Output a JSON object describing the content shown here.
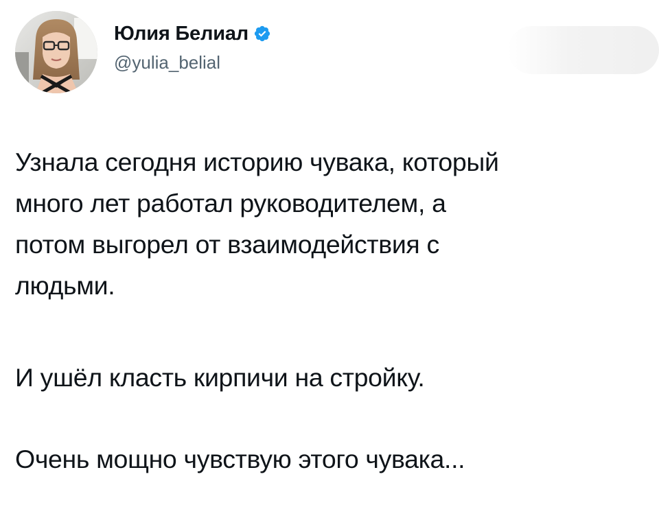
{
  "author": {
    "display_name": "Юлия Белиал",
    "handle": "@yulia_belial",
    "verified": true,
    "verified_color": "#1d9bf0",
    "avatar_icon": "profile-photo"
  },
  "tweet": {
    "paragraphs": [
      [
        "Узнала сегодня историю чувака, который",
        "много лет работал руководителем, а",
        "потом выгорел от взаимодействия с",
        "людьми."
      ],
      [
        "И ушёл класть кирпичи на стройку."
      ],
      [
        "Очень мощно чувствую этого чувака..."
      ]
    ]
  },
  "colors": {
    "text": "#0f1419",
    "secondary_text": "#536471",
    "background": "#ffffff"
  }
}
